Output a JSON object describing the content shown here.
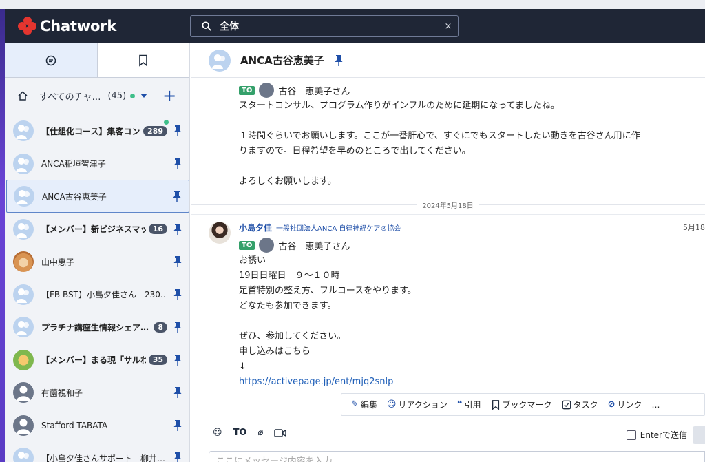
{
  "app": {
    "name": "Chatwork"
  },
  "search": {
    "value": "全体",
    "clear_icon": "×"
  },
  "sidebar": {
    "filter": {
      "label": "すべてのチャ…",
      "count": "(45)"
    },
    "rooms": [
      {
        "name": "【仕組化コース】集客コン…",
        "badge": "289",
        "bold": true,
        "avatar": "group",
        "dot": true
      },
      {
        "name": "ANCA稲垣智津子",
        "badge": "",
        "bold": false,
        "avatar": "group"
      },
      {
        "name": "ANCA古谷恵美子",
        "badge": "",
        "bold": false,
        "avatar": "group",
        "selected": true
      },
      {
        "name": "【メンバー】新ビジネスマッ…",
        "badge": "16",
        "bold": true,
        "avatar": "group"
      },
      {
        "name": "山中恵子",
        "badge": "",
        "bold": false,
        "avatar": "cat"
      },
      {
        "name": "【FB-BST】小島夕佳さん　230…",
        "badge": "",
        "bold": false,
        "avatar": "group"
      },
      {
        "name": "プラチナ講座生情報シェア…",
        "badge": "8",
        "bold": true,
        "avatar": "group"
      },
      {
        "name": "【メンバー】まる現「サルわ…",
        "badge": "35",
        "bold": true,
        "avatar": "monkey"
      },
      {
        "name": "有薗視和子",
        "badge": "",
        "bold": false,
        "avatar": "person"
      },
      {
        "name": "Stafford TABATA",
        "badge": "",
        "bold": false,
        "avatar": "person"
      },
      {
        "name": "【小島夕佳さんサポート　柳井…",
        "badge": "",
        "bold": false,
        "avatar": "group"
      }
    ]
  },
  "chat": {
    "title": "ANCA古谷恵美子",
    "message1": {
      "to_chip": "TO",
      "to_name": "古谷　恵美子さん",
      "lines": [
        "スタートコンサル、プログラム作りがインフルのために延期になってましたね。",
        "",
        "１時間ぐらいでお願いします。ここが一番肝心で、すぐにでもスタートしたい動きを古谷さん用に作",
        "りますので。日程希望を早めのところで出してください。",
        "",
        "よろしくお願いします。"
      ]
    },
    "date_separator": "2024年5月18日",
    "message2": {
      "sender": "小島夕佳",
      "org": "一般社団法人ANCA 自律神経ケア®協会",
      "time": "5月18",
      "to_chip": "TO",
      "to_name": "古谷　恵美子さん",
      "lines": [
        "お誘い",
        "19日日曜日　９～１０時",
        "足首特別の整え方、フルコースをやります。",
        "どなたも参加できます。",
        "",
        "ぜひ、参加してください。",
        "申し込みはこちら",
        "↓"
      ],
      "link": "https://activepage.jp/ent/mjq2snlp"
    },
    "actions": {
      "edit": "編集",
      "reaction": "リアクション",
      "quote": "引用",
      "bookmark": "ブックマーク",
      "task": "タスク",
      "link": "リンク",
      "more": "…"
    },
    "composer": {
      "to_label": "TO",
      "enter_send": "Enterで送信",
      "placeholder": "ここにメッセージ内容を入力"
    }
  },
  "colors": {
    "header_bg": "#1f2636",
    "accent": "#1f4fa8",
    "to_chip": "#34a06a",
    "logo": "#e4352f"
  }
}
